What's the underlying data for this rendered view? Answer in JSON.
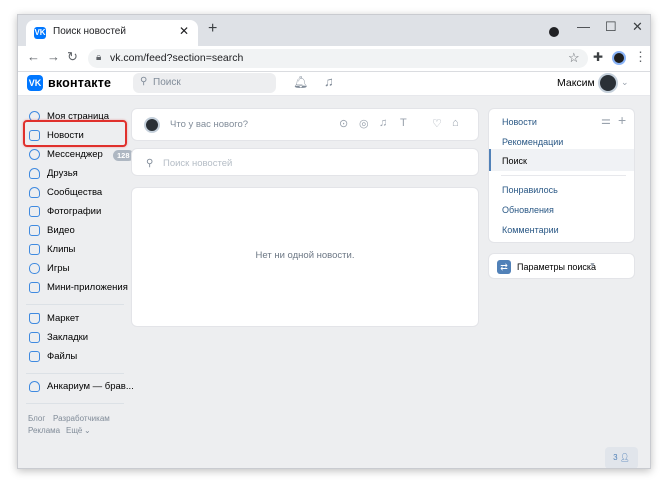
{
  "browser": {
    "tab_title": "Поиск новостей",
    "tab_favicon_letter": "VK",
    "address": "vk.com/feed?section=search"
  },
  "vk_header": {
    "logo_text": "вконтакте",
    "search_placeholder": "Поиск",
    "user_name": "Максим"
  },
  "left_menu": {
    "items": [
      {
        "label": "Моя страница"
      },
      {
        "label": "Новости"
      },
      {
        "label": "Мессенджер",
        "badge": "128"
      },
      {
        "label": "Друзья"
      },
      {
        "label": "Сообщества"
      },
      {
        "label": "Фотографии"
      },
      {
        "label": "Видео"
      },
      {
        "label": "Клипы"
      },
      {
        "label": "Игры"
      },
      {
        "label": "Мини-приложения"
      },
      {
        "label": "Маркет"
      },
      {
        "label": "Закладки"
      },
      {
        "label": "Файлы"
      },
      {
        "label": "Анкариум — брав..."
      }
    ],
    "footer": {
      "blog": "Блог",
      "developers": "Разработчикам",
      "ads": "Реклама",
      "more": "Ещё"
    }
  },
  "center": {
    "post_placeholder": "Что у вас нового?",
    "news_search_placeholder": "Поиск новостей",
    "empty_text": "Нет ни одной новости."
  },
  "right_filter": {
    "items": [
      {
        "label": "Новости"
      },
      {
        "label": "Рекомендации"
      },
      {
        "label": "Поиск"
      },
      {
        "label": "Понравилось"
      },
      {
        "label": "Обновления"
      },
      {
        "label": "Комментарии"
      }
    ],
    "active": "Поиск",
    "params_label": "Параметры поиска"
  },
  "floating": {
    "count": "3"
  },
  "colors": {
    "accent": "#0077ff",
    "link": "#2a5885",
    "highlight": "#e0302c",
    "page_bg": "#edeef0"
  }
}
